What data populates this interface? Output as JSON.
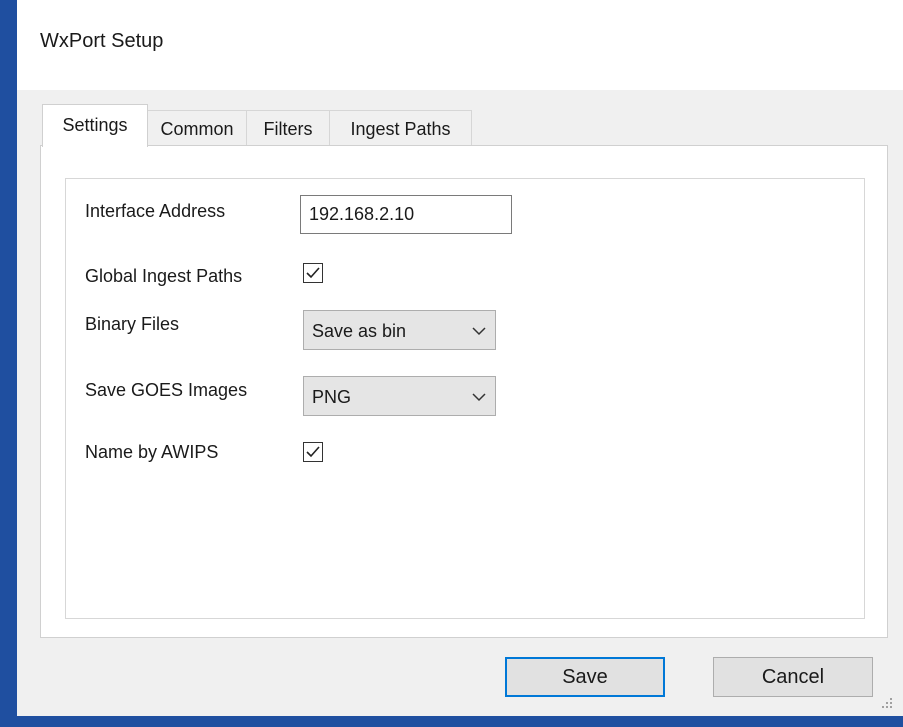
{
  "window": {
    "title": "WxPort Setup"
  },
  "tabs": [
    {
      "label": "Settings",
      "active": true
    },
    {
      "label": "Common",
      "active": false
    },
    {
      "label": "Filters",
      "active": false
    },
    {
      "label": "Ingest Paths",
      "active": false
    }
  ],
  "settings": {
    "interface_address": {
      "label": "Interface Address",
      "value": "192.168.2.10"
    },
    "global_ingest_paths": {
      "label": "Global Ingest Paths",
      "checked": true
    },
    "binary_files": {
      "label": "Binary Files",
      "selected": "Save as bin"
    },
    "save_goes_images": {
      "label": "Save GOES Images",
      "selected": "PNG"
    },
    "name_by_awips": {
      "label": "Name by AWIPS",
      "checked": true
    }
  },
  "buttons": {
    "save_label": "Save",
    "cancel_label": "Cancel"
  },
  "icons": {
    "check": "check-icon",
    "dropdown": "chevron-down-icon",
    "grip": "resize-grip-icon"
  },
  "colors": {
    "window_border": "#1f4fa0",
    "default_button_border": "#0078d7",
    "panel_background": "#ffffff",
    "dialog_background": "#f0f0f0"
  }
}
